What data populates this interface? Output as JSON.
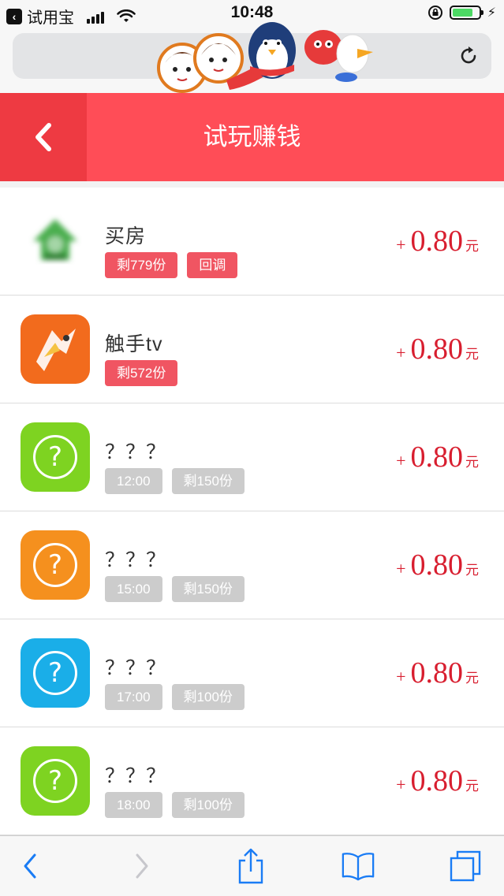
{
  "status_bar": {
    "back_app": "试用宝",
    "time": "10:48"
  },
  "header": {
    "title": "试玩赚钱"
  },
  "colors": {
    "header_red": "#ff4d57",
    "back_red": "#ee3a42",
    "reward_red": "#d81e2f",
    "tag_red": "#f05562",
    "tag_gray": "#cccccc",
    "icon_green": "#7ed321",
    "icon_orange": "#f5901e",
    "icon_blue": "#1aaee8"
  },
  "tasks": [
    {
      "name": "买房",
      "icon": "green-house-icon",
      "tags": [
        "剩779份",
        "回调"
      ],
      "plus": "+",
      "amount": "0.80",
      "unit": "元"
    },
    {
      "name": "触手tv",
      "icon": "chushou-tv-icon",
      "tags": [
        "剩572份"
      ],
      "plus": "+",
      "amount": "0.80",
      "unit": "元"
    },
    {
      "name": "？？？",
      "icon": "question-icon",
      "tags": [
        "12:00",
        "剩150份"
      ],
      "plus": "+",
      "amount": "0.80",
      "unit": "元"
    },
    {
      "name": "？？？",
      "icon": "question-icon",
      "tags": [
        "15:00",
        "剩150份"
      ],
      "plus": "+",
      "amount": "0.80",
      "unit": "元"
    },
    {
      "name": "？？？",
      "icon": "question-icon",
      "tags": [
        "17:00",
        "剩100份"
      ],
      "plus": "+",
      "amount": "0.80",
      "unit": "元"
    },
    {
      "name": "？？？",
      "icon": "question-icon",
      "tags": [
        "18:00",
        "剩100份"
      ],
      "plus": "+",
      "amount": "0.80",
      "unit": "元"
    }
  ]
}
